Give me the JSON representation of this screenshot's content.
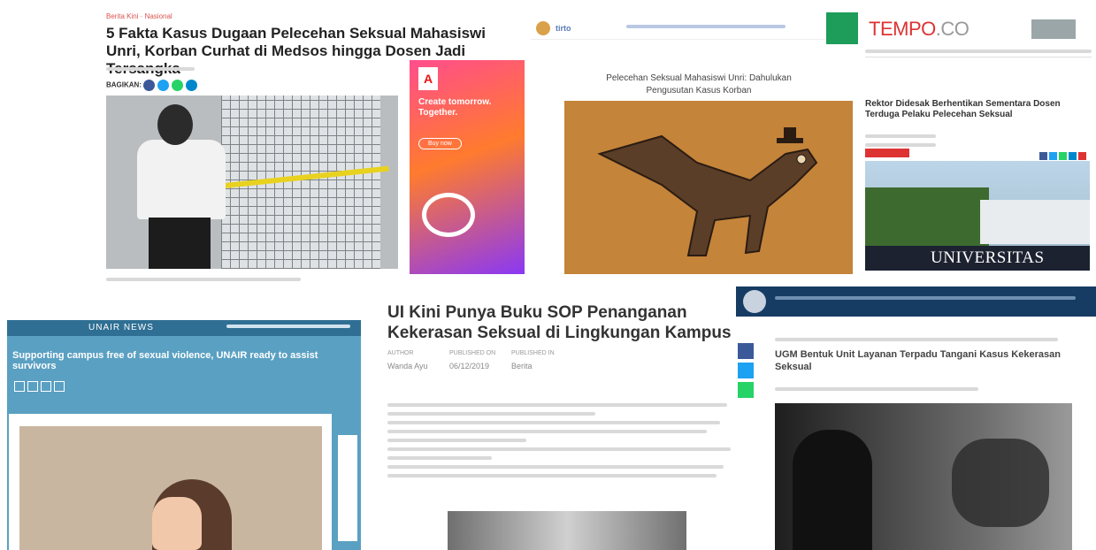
{
  "panel1": {
    "category": "Berita Kini · Nasional",
    "title": "5 Fakta Kasus Dugaan Pelecehan Seksual Mahasiswi Unri, Korban Curhat di Medsos hingga Dosen Jadi Tersangka",
    "share_label": "BAGIKAN:",
    "share_colors": [
      "#3b5998",
      "#1da1f2",
      "#25d366",
      "#0088cc"
    ],
    "ad": {
      "logo": "A",
      "title": "Create tomorrow. Together.",
      "button": "Buy now"
    }
  },
  "panel2": {
    "site": "tirto",
    "headline": "Pelecehan Seksual Mahasiswi Unri: Dahulukan Pengusutan Kasus Korban"
  },
  "panel3": {
    "logo_main": "TEMPO",
    "logo_suffix": ".CO",
    "title": "Rektor Didesak Berhentikan Sementara Dosen Terduga Pelaku Pelecehan Seksual",
    "banner": "UNIVERSITAS RIAU",
    "share_colors": [
      "#3b5998",
      "#1da1f2",
      "#25d366",
      "#0088cc",
      "#d33"
    ]
  },
  "panel4": {
    "brand": "UNAIR NEWS",
    "title": "Supporting campus free of sexual violence, UNAIR ready to assist survivors"
  },
  "panel5": {
    "title": "UI Kini Punya Buku SOP Penanganan Kekerasan Seksual di Lingkungan Kampus",
    "labels": [
      "AUTHOR",
      "PUBLISHED ON",
      "PUBLISHED IN"
    ],
    "values": [
      "Wanda Ayu",
      "06/12/2019",
      "Berita"
    ]
  },
  "panel6": {
    "title": "UGM Bentuk Unit Layanan Terpadu Tangani Kasus Kekerasan Seksual",
    "social_colors": [
      "#3b5998",
      "#1da1f2",
      "#25d366"
    ]
  }
}
